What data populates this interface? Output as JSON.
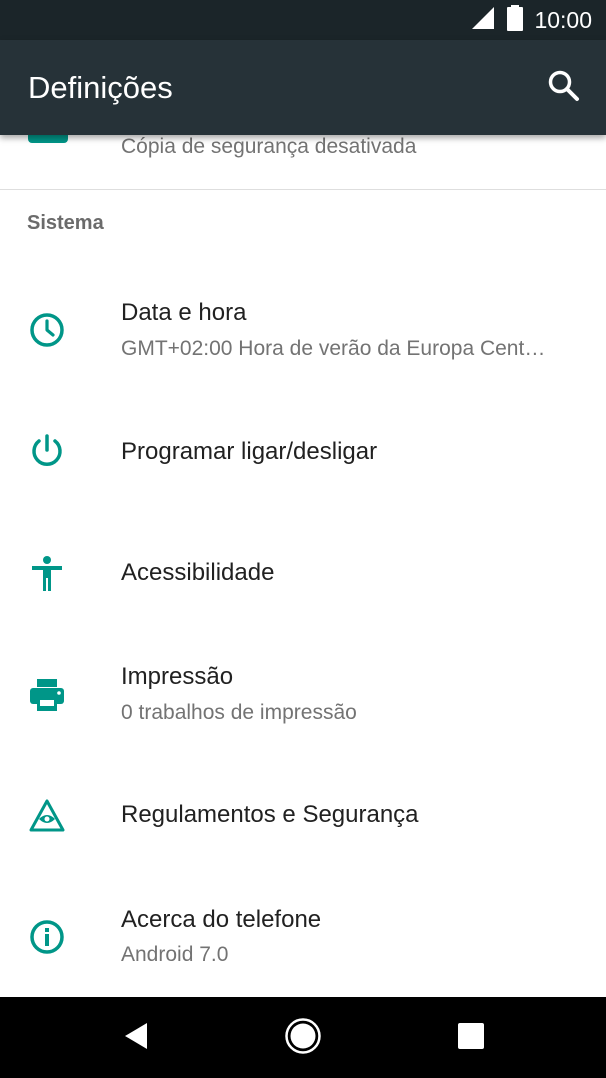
{
  "status_bar": {
    "time": "10:00",
    "signal_icon": "cell-signal-icon",
    "battery_icon": "battery-icon"
  },
  "app_bar": {
    "title": "Definições",
    "search_icon": "search-icon"
  },
  "partial_item": {
    "subtitle": "Cópia de segurança desativada",
    "icon": "backup-icon"
  },
  "section": {
    "header": "Sistema"
  },
  "items": [
    {
      "title": "Data e hora",
      "subtitle": "GMT+02:00 Hora de verão da Europa Cent…",
      "icon": "clock-icon"
    },
    {
      "title": "Programar ligar/desligar",
      "subtitle": "",
      "icon": "power-icon"
    },
    {
      "title": "Acessibilidade",
      "subtitle": "",
      "icon": "accessibility-icon"
    },
    {
      "title": "Impressão",
      "subtitle": "0 trabalhos de impressão",
      "icon": "printer-icon"
    },
    {
      "title": "Regulamentos e Segurança",
      "subtitle": "",
      "icon": "regulatory-icon"
    },
    {
      "title": "Acerca do telefone",
      "subtitle": "Android 7.0",
      "icon": "info-icon"
    }
  ],
  "nav_bar": {
    "back_icon": "back-icon",
    "home_icon": "home-icon",
    "recents_icon": "recents-icon"
  },
  "colors": {
    "accent": "#009688",
    "app_bar": "#263238",
    "status_bar": "#1b2529"
  }
}
